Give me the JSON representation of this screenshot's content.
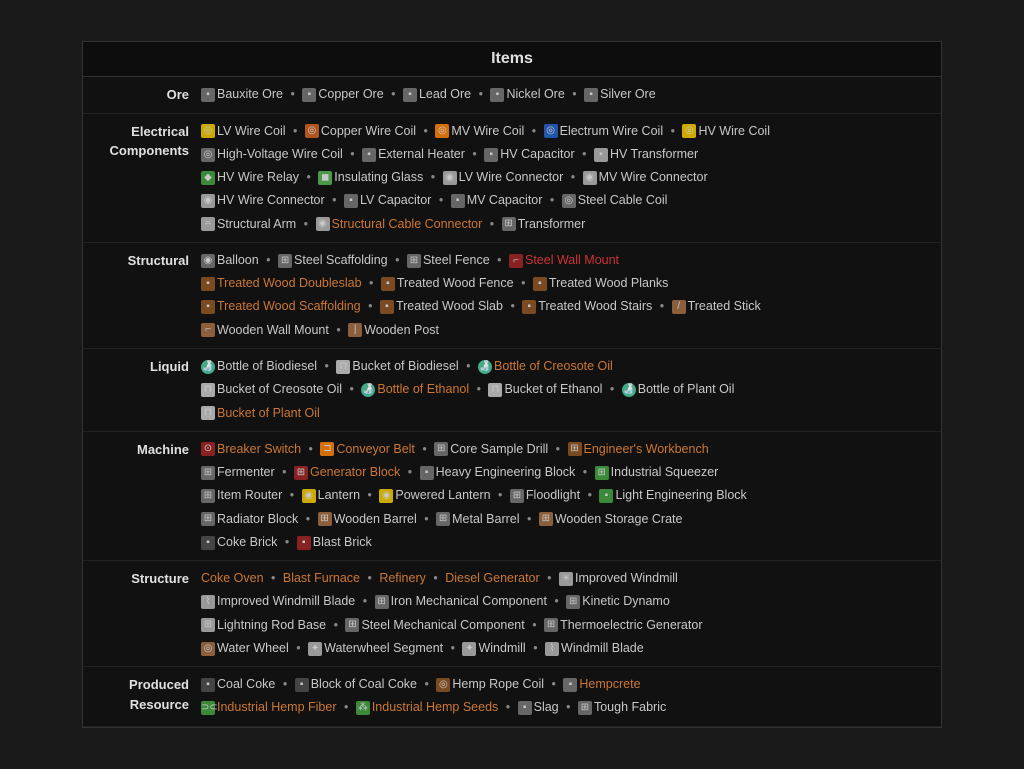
{
  "title": "Items",
  "categories": [
    {
      "id": "ore",
      "label": "Ore",
      "lines": [
        {
          "items": [
            {
              "icon": "gray-block",
              "iconClass": "ico-gray",
              "name": "Bauxite Ore",
              "style": "normal"
            },
            {
              "icon": "gray-block",
              "iconClass": "ico-gray",
              "name": "Copper Ore",
              "style": "normal"
            },
            {
              "icon": "gray-block",
              "iconClass": "ico-gray",
              "name": "Lead Ore",
              "style": "normal"
            },
            {
              "icon": "gray-block",
              "iconClass": "ico-gray",
              "name": "Nickel Ore",
              "style": "normal"
            },
            {
              "icon": "gray-block",
              "iconClass": "ico-gray",
              "name": "Silver Ore",
              "style": "normal"
            }
          ]
        }
      ]
    },
    {
      "id": "electrical",
      "label": "Electrical Components",
      "lines": [
        {
          "items": [
            {
              "icon": "coil",
              "iconClass": "ico-yellow",
              "name": "LV Wire Coil",
              "style": "normal"
            },
            {
              "icon": "coil",
              "iconClass": "ico-copper",
              "name": "Copper Wire Coil",
              "style": "normal"
            },
            {
              "icon": "coil",
              "iconClass": "ico-orange",
              "name": "MV Wire Coil",
              "style": "normal"
            },
            {
              "icon": "coil",
              "iconClass": "ico-blue",
              "name": "Electrum Wire Coil",
              "style": "normal"
            },
            {
              "icon": "coil",
              "iconClass": "ico-yellow",
              "name": "HV Wire Coil",
              "style": "normal"
            }
          ]
        },
        {
          "items": [
            {
              "icon": "coil",
              "iconClass": "ico-gray",
              "name": "High-Voltage Wire Coil",
              "style": "normal"
            },
            {
              "icon": "block",
              "iconClass": "ico-gray",
              "name": "External Heater",
              "style": "normal"
            },
            {
              "icon": "block",
              "iconClass": "ico-gray",
              "name": "HV Capacitor",
              "style": "normal"
            },
            {
              "icon": "block",
              "iconClass": "ico-silver",
              "name": "HV Transformer",
              "style": "normal"
            }
          ]
        },
        {
          "items": [
            {
              "icon": "relay",
              "iconClass": "ico-green",
              "name": "HV Wire Relay",
              "style": "normal"
            },
            {
              "icon": "glass",
              "iconClass": "ico-green-block",
              "name": "Insulating Glass",
              "style": "normal"
            },
            {
              "icon": "conn",
              "iconClass": "ico-silver",
              "name": "LV Wire Connector",
              "style": "normal"
            },
            {
              "icon": "conn",
              "iconClass": "ico-silver",
              "name": "MV Wire Connector",
              "style": "normal"
            }
          ]
        },
        {
          "items": [
            {
              "icon": "conn",
              "iconClass": "ico-silver",
              "name": "HV Wire Connector",
              "style": "normal"
            },
            {
              "icon": "block",
              "iconClass": "ico-gray",
              "name": "LV Capacitor",
              "style": "normal"
            },
            {
              "icon": "block",
              "iconClass": "ico-gray",
              "name": "MV Capacitor",
              "style": "normal"
            },
            {
              "icon": "coil",
              "iconClass": "ico-gray",
              "name": "Steel Cable Coil",
              "style": "normal"
            }
          ]
        },
        {
          "items": [
            {
              "icon": "arm",
              "iconClass": "ico-silver",
              "name": "Structural Arm",
              "style": "normal"
            },
            {
              "icon": "conn",
              "iconClass": "ico-silver",
              "name": "Structural Cable Connector",
              "style": "orange"
            },
            {
              "icon": "trans",
              "iconClass": "ico-gray",
              "name": "Transformer",
              "style": "normal"
            }
          ]
        }
      ]
    },
    {
      "id": "structural",
      "label": "Structural",
      "lines": [
        {
          "items": [
            {
              "icon": "balloon",
              "iconClass": "ico-gray",
              "name": "Balloon",
              "style": "normal"
            },
            {
              "icon": "scaff",
              "iconClass": "ico-gray",
              "name": "Steel Scaffolding",
              "style": "normal"
            },
            {
              "icon": "fence",
              "iconClass": "ico-gray",
              "name": "Steel Fence",
              "style": "normal"
            },
            {
              "icon": "mount",
              "iconClass": "ico-red",
              "name": "Steel Wall Mount",
              "style": "red"
            }
          ]
        },
        {
          "items": [
            {
              "icon": "wood-block",
              "iconClass": "ico-brown",
              "name": "Treated Wood Doubleslab",
              "style": "orange"
            },
            {
              "icon": "wood-block",
              "iconClass": "ico-brown",
              "name": "Treated Wood Fence",
              "style": "normal"
            },
            {
              "icon": "wood-block",
              "iconClass": "ico-brown",
              "name": "Treated Wood Planks",
              "style": "normal"
            }
          ]
        },
        {
          "items": [
            {
              "icon": "wood-block",
              "iconClass": "ico-brown",
              "name": "Treated Wood Scaffolding",
              "style": "orange"
            },
            {
              "icon": "wood-block",
              "iconClass": "ico-brown",
              "name": "Treated Wood Slab",
              "style": "normal"
            },
            {
              "icon": "wood-block",
              "iconClass": "ico-brown",
              "name": "Treated Wood Stairs",
              "style": "normal"
            },
            {
              "icon": "stick",
              "iconClass": "ico-wood",
              "name": "Treated Stick",
              "style": "normal"
            }
          ]
        },
        {
          "items": [
            {
              "icon": "mount",
              "iconClass": "ico-wood",
              "name": "Wooden Wall Mount",
              "style": "normal"
            },
            {
              "icon": "post",
              "iconClass": "ico-wood",
              "name": "Wooden Post",
              "style": "normal"
            }
          ]
        }
      ]
    },
    {
      "id": "liquid",
      "label": "Liquid",
      "lines": [
        {
          "items": [
            {
              "icon": "bottle",
              "iconClass": "ico-bottle",
              "name": "Bottle of Biodiesel",
              "style": "normal"
            },
            {
              "icon": "bucket",
              "iconClass": "ico-bucket",
              "name": "Bucket of Biodiesel",
              "style": "normal"
            },
            {
              "icon": "bottle",
              "iconClass": "ico-bottle",
              "name": "Bottle of Creosote Oil",
              "style": "orange"
            }
          ]
        },
        {
          "items": [
            {
              "icon": "bucket",
              "iconClass": "ico-bucket",
              "name": "Bucket of Creosote Oil",
              "style": "normal"
            },
            {
              "icon": "bottle",
              "iconClass": "ico-bottle",
              "name": "Bottle of Ethanol",
              "style": "orange"
            },
            {
              "icon": "bucket",
              "iconClass": "ico-bucket",
              "name": "Bucket of Ethanol",
              "style": "normal"
            },
            {
              "icon": "bottle",
              "iconClass": "ico-bottle",
              "name": "Bottle of Plant Oil",
              "style": "normal"
            }
          ]
        },
        {
          "items": [
            {
              "icon": "bucket",
              "iconClass": "ico-bucket",
              "name": "Bucket of Plant Oil",
              "style": "orange"
            }
          ]
        }
      ]
    },
    {
      "id": "machine",
      "label": "Machine",
      "lines": [
        {
          "items": [
            {
              "icon": "switch",
              "iconClass": "ico-red",
              "name": "Breaker Switch",
              "style": "orange"
            },
            {
              "icon": "belt",
              "iconClass": "ico-orange",
              "name": "Conveyor Belt",
              "style": "orange"
            },
            {
              "icon": "drill",
              "iconClass": "ico-gray",
              "name": "Core Sample Drill",
              "style": "normal"
            },
            {
              "icon": "bench",
              "iconClass": "ico-brown",
              "name": "Engineer's Workbench",
              "style": "orange"
            }
          ]
        },
        {
          "items": [
            {
              "icon": "ferm",
              "iconClass": "ico-gray",
              "name": "Fermenter",
              "style": "normal"
            },
            {
              "icon": "gen",
              "iconClass": "ico-red",
              "name": "Generator Block",
              "style": "orange"
            },
            {
              "icon": "block",
              "iconClass": "ico-gray",
              "name": "Heavy Engineering Block",
              "style": "normal"
            },
            {
              "icon": "squeezer",
              "iconClass": "ico-green",
              "name": "Industrial Squeezer",
              "style": "normal"
            }
          ]
        },
        {
          "items": [
            {
              "icon": "router",
              "iconClass": "ico-gray",
              "name": "Item Router",
              "style": "normal"
            },
            {
              "icon": "lantern",
              "iconClass": "ico-yellow",
              "name": "Lantern",
              "style": "normal"
            },
            {
              "icon": "lantern",
              "iconClass": "ico-yellow",
              "name": "Powered Lantern",
              "style": "normal"
            },
            {
              "icon": "flood",
              "iconClass": "ico-gray",
              "name": "Floodlight",
              "style": "normal"
            },
            {
              "icon": "block",
              "iconClass": "ico-green",
              "name": "Light Engineering Block",
              "style": "normal"
            }
          ]
        },
        {
          "items": [
            {
              "icon": "radiator",
              "iconClass": "ico-gray",
              "name": "Radiator Block",
              "style": "normal"
            },
            {
              "icon": "barrel",
              "iconClass": "ico-wood",
              "name": "Wooden Barrel",
              "style": "normal"
            },
            {
              "icon": "barrel",
              "iconClass": "ico-gray",
              "name": "Metal Barrel",
              "style": "normal"
            },
            {
              "icon": "crate",
              "iconClass": "ico-wood",
              "name": "Wooden Storage Crate",
              "style": "normal"
            }
          ]
        },
        {
          "items": [
            {
              "icon": "brick",
              "iconClass": "ico-dark",
              "name": "Coke Brick",
              "style": "normal"
            },
            {
              "icon": "brick",
              "iconClass": "ico-red",
              "name": "Blast Brick",
              "style": "normal"
            }
          ]
        }
      ]
    },
    {
      "id": "structure",
      "label": "Structure",
      "lines": [
        {
          "items": [
            {
              "icon": "none",
              "iconClass": "",
              "name": "Coke Oven",
              "style": "orange"
            },
            {
              "icon": "none",
              "iconClass": "",
              "name": "Blast Furnace",
              "style": "orange"
            },
            {
              "icon": "none",
              "iconClass": "",
              "name": "Refinery",
              "style": "orange"
            },
            {
              "icon": "none",
              "iconClass": "",
              "name": "Diesel Generator",
              "style": "orange"
            },
            {
              "icon": "windmill",
              "iconClass": "ico-silver",
              "name": "Improved Windmill",
              "style": "normal"
            }
          ]
        },
        {
          "items": [
            {
              "icon": "blade",
              "iconClass": "ico-silver",
              "name": "Improved Windmill Blade",
              "style": "normal"
            },
            {
              "icon": "mech",
              "iconClass": "ico-gray",
              "name": "Iron Mechanical Component",
              "style": "normal"
            },
            {
              "icon": "dynamo",
              "iconClass": "ico-gray",
              "name": "Kinetic Dynamo",
              "style": "normal"
            }
          ]
        },
        {
          "items": [
            {
              "icon": "rod",
              "iconClass": "ico-silver",
              "name": "Lightning Rod Base",
              "style": "normal"
            },
            {
              "icon": "mech",
              "iconClass": "ico-gray",
              "name": "Steel Mechanical Component",
              "style": "normal"
            },
            {
              "icon": "thermo",
              "iconClass": "ico-gray",
              "name": "Thermoelectric Generator",
              "style": "normal"
            }
          ]
        },
        {
          "items": [
            {
              "icon": "wheel",
              "iconClass": "ico-wood",
              "name": "Water Wheel",
              "style": "normal"
            },
            {
              "icon": "seg",
              "iconClass": "ico-silver",
              "name": "Waterwheel Segment",
              "style": "normal"
            },
            {
              "icon": "seg",
              "iconClass": "ico-silver",
              "name": "Windmill",
              "style": "normal"
            },
            {
              "icon": "blade",
              "iconClass": "ico-silver",
              "name": "Windmill Blade",
              "style": "normal"
            }
          ]
        }
      ]
    },
    {
      "id": "produced",
      "label": "Produced Resource",
      "lines": [
        {
          "items": [
            {
              "icon": "coke",
              "iconClass": "ico-dark",
              "name": "Coal Coke",
              "style": "normal"
            },
            {
              "icon": "block",
              "iconClass": "ico-dark",
              "name": "Block of Coal Coke",
              "style": "normal"
            },
            {
              "icon": "coil",
              "iconClass": "ico-brown",
              "name": "Hemp Rope Coil",
              "style": "normal"
            },
            {
              "icon": "block",
              "iconClass": "ico-gray",
              "name": "Hempcrete",
              "style": "orange"
            }
          ]
        },
        {
          "items": [
            {
              "icon": "hemp",
              "iconClass": "ico-green",
              "name": "Industrial Hemp Fiber",
              "style": "orange"
            },
            {
              "icon": "seeds",
              "iconClass": "ico-green",
              "name": "Industrial Hemp Seeds",
              "style": "orange"
            },
            {
              "icon": "slag",
              "iconClass": "ico-gray",
              "name": "Slag",
              "style": "normal"
            },
            {
              "icon": "fabric",
              "iconClass": "ico-gray",
              "name": "Tough Fabric",
              "style": "normal"
            }
          ]
        }
      ]
    }
  ]
}
